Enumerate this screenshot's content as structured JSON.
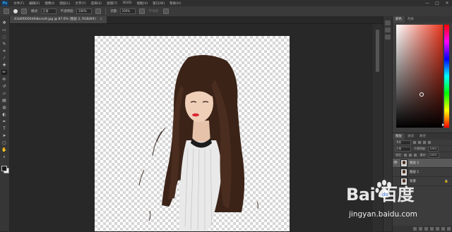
{
  "app": {
    "logo": "Ps"
  },
  "menu": [
    "文件(F)",
    "编辑(E)",
    "图像(I)",
    "图层(L)",
    "文字(Y)",
    "选择(S)",
    "滤镜(T)",
    "3D(D)",
    "视图(V)",
    "窗口(W)",
    "帮助(H)"
  ],
  "window_controls": [
    "—",
    "□",
    "✕"
  ],
  "options_bar": {
    "mode_label": "模式:",
    "mode_value": "正常",
    "opacity_label": "不透明度:",
    "opacity_value": "100%",
    "flow_label": "流量:",
    "flow_value": "100%",
    "faded_label": "平滑度:"
  },
  "document": {
    "tab_title": "41b6f0000d9dbcea9.jpg @ 87.6% (图层 2, RGB/8#)",
    "close": "×"
  },
  "color_panel": {
    "tabs": [
      "颜色",
      "色板"
    ]
  },
  "layers_panel": {
    "tabs": [
      "图层",
      "通道",
      "路径"
    ],
    "kind_label": "类型",
    "blend_mode": "正常",
    "opacity_label": "不透明度:",
    "opacity_value": "100%",
    "lock_label": "锁定:",
    "fill_label": "填充:",
    "fill_value": "100%",
    "layers": [
      {
        "name": "图层 2",
        "visible": "👁",
        "locked": ""
      },
      {
        "name": "图层 1",
        "visible": "",
        "locked": ""
      },
      {
        "name": "背景",
        "visible": "",
        "locked": "🔒"
      }
    ]
  },
  "watermark": {
    "logo": "Bai  百度",
    "url": "jingyan.baidu.com"
  },
  "colors": {
    "accent": "#31a8ff",
    "picker_red": "#e8371e"
  }
}
